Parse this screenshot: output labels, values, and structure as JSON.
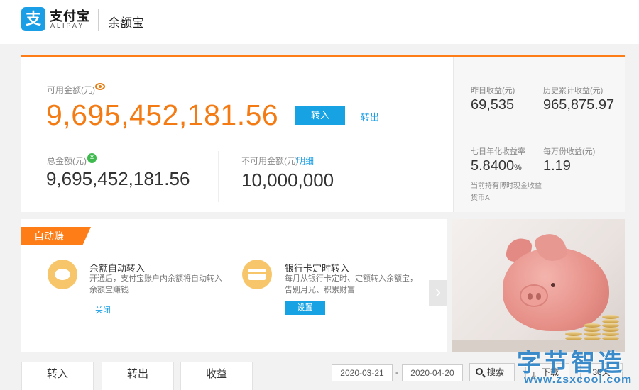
{
  "header": {
    "logo_glyph": "支",
    "logo_cn": "支付宝",
    "logo_en": "ALIPAY",
    "product": "余额宝"
  },
  "balance": {
    "available_label": "可用金额(元)",
    "available_amount": "9,695,452,181.56",
    "transfer_in_button": "转入",
    "transfer_out_link": "转出",
    "total_label": "总金额(元)",
    "yen_glyph": "¥",
    "total_amount": "9,695,452,181.56",
    "unavailable_label": "不可用金额(元)",
    "detail_link": "明细",
    "unavailable_amount": "10,000,000"
  },
  "stats": {
    "yesterday_label": "昨日收益(元)",
    "yesterday_value": "69,535",
    "cumulative_label": "历史累计收益(元)",
    "cumulative_value": "965,875.97",
    "seven_day_label": "七日年化收益率",
    "seven_day_value": "5.8400",
    "seven_day_unit": "%",
    "per_10k_label": "每万份收益(元)",
    "per_10k_value": "1.19",
    "note_line1": "当前持有博时现金收益",
    "note_line2": "货币A"
  },
  "auto_earn": {
    "tag": "自动赚",
    "feature1": {
      "title": "余额自动转入",
      "desc": "开通后，支付宝账户内余额将自动转入余额宝赚钱",
      "action": "关闭"
    },
    "feature2": {
      "title": "银行卡定时转入",
      "desc": "每月从银行卡定时、定额转入余额宝，告别月光、积累财富",
      "action": "设置"
    },
    "next_glyph": "›"
  },
  "tabs": [
    "转入",
    "转出",
    "收益"
  ],
  "filter": {
    "start_date": "2020-03-21",
    "separator": "-",
    "end_date": "2020-04-20",
    "search_label": "搜索",
    "download_label": "下载",
    "download_glyph": "⤓",
    "range_label": "30天"
  },
  "watermark": {
    "cn": "字节智造",
    "url": "www.zsxcool.com"
  },
  "colors": {
    "accent_orange": "#ff7d16",
    "amount_orange": "#f47b13",
    "primary_blue": "#17a3e3"
  }
}
